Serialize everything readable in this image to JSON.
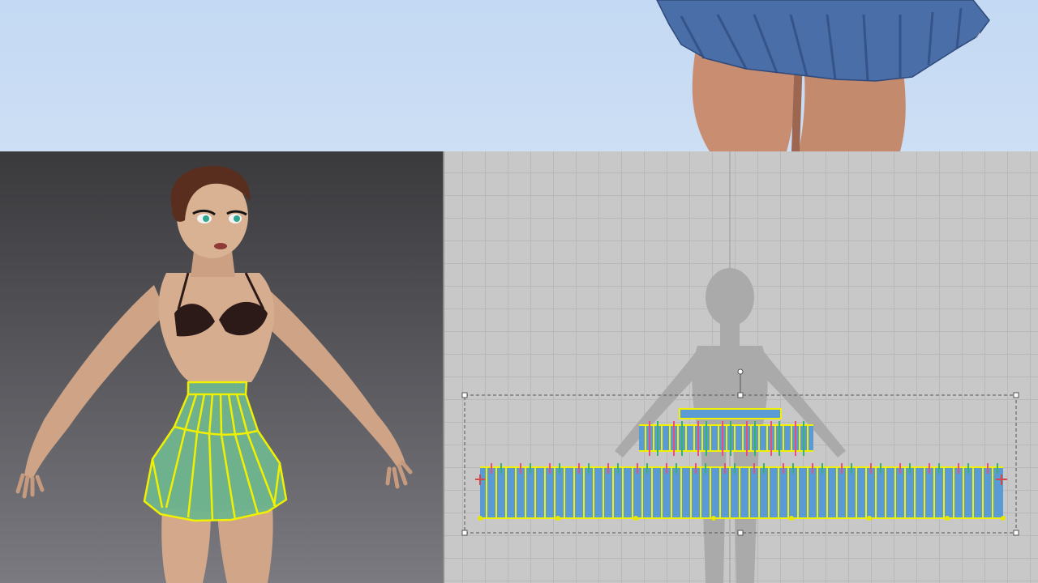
{
  "banner": {
    "title": "",
    "sky_color": "#c8dbf3",
    "skirt_color": "#4a6ea8"
  },
  "viewport_3d": {
    "background_top": "#3a3a3d",
    "background_bottom": "#7a7a80",
    "skin_color": "#d7ad8f",
    "hair_color": "#5a2e1e",
    "top_color": "#2c1a18",
    "skirt_color": "#6fb58e",
    "seam_color": "#f0f000"
  },
  "pattern_window": {
    "grid_color": "#b9b9b9",
    "panel_fill": "#5b9bd5",
    "seam_color": "#f0f000",
    "avatar_silhouette_color": "#a9a9a9",
    "selection_box": "dashed"
  }
}
